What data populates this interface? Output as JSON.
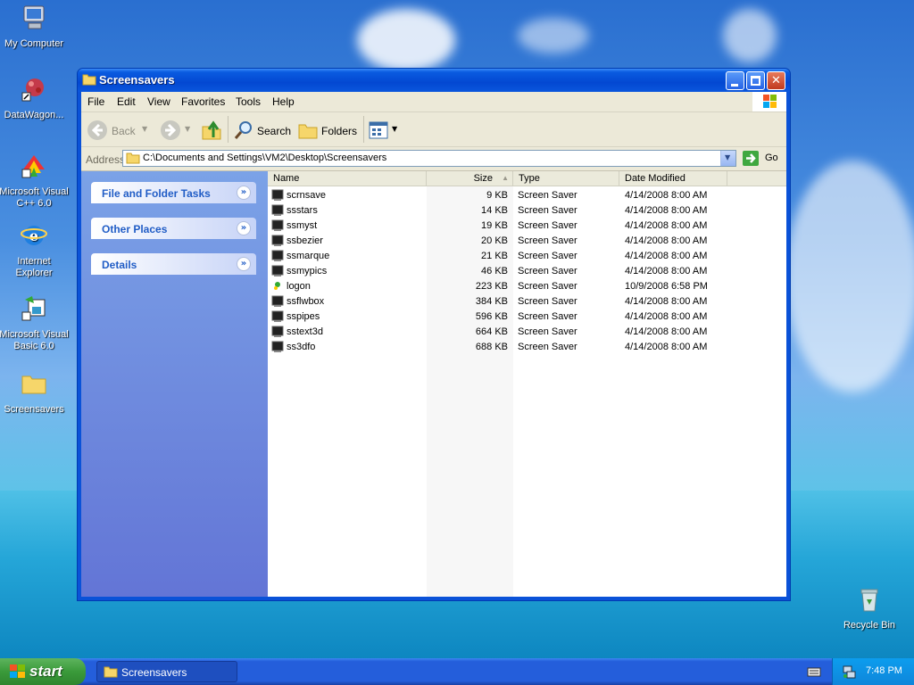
{
  "desktop": {
    "icons": [
      {
        "label": "My Computer"
      },
      {
        "label": "DataWagon..."
      },
      {
        "label": "Microsoft Visual C++ 6.0"
      },
      {
        "label": "Internet Explorer"
      },
      {
        "label": "Microsoft Visual Basic 6.0"
      },
      {
        "label": "Screensavers"
      },
      {
        "label": "Recycle Bin"
      }
    ]
  },
  "window": {
    "title": "Screensavers",
    "menu": [
      "File",
      "Edit",
      "View",
      "Favorites",
      "Tools",
      "Help"
    ],
    "toolbar": {
      "back": "Back",
      "search": "Search",
      "folders": "Folders"
    },
    "address": {
      "label": "Address",
      "value": "C:\\Documents and Settings\\VM2\\Desktop\\Screensavers",
      "go": "Go"
    },
    "tasks": [
      "File and Folder Tasks",
      "Other Places",
      "Details"
    ],
    "columns": [
      "Name",
      "Size",
      "Type",
      "Date Modified"
    ],
    "files": [
      {
        "name": "scrnsave",
        "size": "9 KB",
        "type": "Screen Saver",
        "date": "4/14/2008 8:00 AM"
      },
      {
        "name": "ssstars",
        "size": "14 KB",
        "type": "Screen Saver",
        "date": "4/14/2008 8:00 AM"
      },
      {
        "name": "ssmyst",
        "size": "19 KB",
        "type": "Screen Saver",
        "date": "4/14/2008 8:00 AM"
      },
      {
        "name": "ssbezier",
        "size": "20 KB",
        "type": "Screen Saver",
        "date": "4/14/2008 8:00 AM"
      },
      {
        "name": "ssmarque",
        "size": "21 KB",
        "type": "Screen Saver",
        "date": "4/14/2008 8:00 AM"
      },
      {
        "name": "ssmypics",
        "size": "46 KB",
        "type": "Screen Saver",
        "date": "4/14/2008 8:00 AM"
      },
      {
        "name": "logon",
        "size": "223 KB",
        "type": "Screen Saver",
        "date": "10/9/2008 6:58 PM"
      },
      {
        "name": "ssflwbox",
        "size": "384 KB",
        "type": "Screen Saver",
        "date": "4/14/2008 8:00 AM"
      },
      {
        "name": "sspipes",
        "size": "596 KB",
        "type": "Screen Saver",
        "date": "4/14/2008 8:00 AM"
      },
      {
        "name": "sstext3d",
        "size": "664 KB",
        "type": "Screen Saver",
        "date": "4/14/2008 8:00 AM"
      },
      {
        "name": "ss3dfo",
        "size": "688 KB",
        "type": "Screen Saver",
        "date": "4/14/2008 8:00 AM"
      }
    ]
  },
  "taskbar": {
    "start": "start",
    "task": "Screensavers",
    "time": "7:48 PM"
  }
}
